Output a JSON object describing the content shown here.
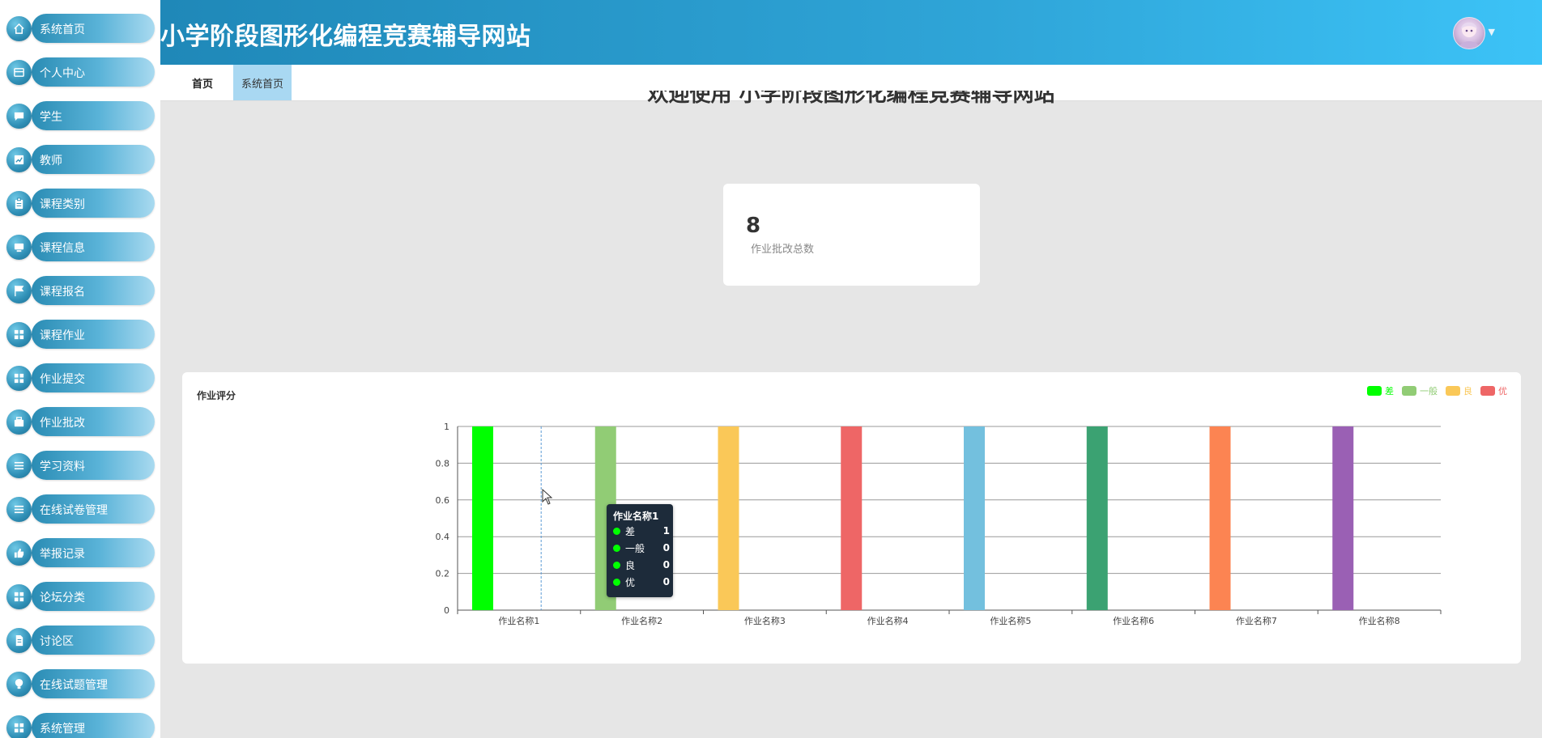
{
  "header": {
    "title": "小学阶段图形化编程竞赛辅导网站",
    "caret": "▼"
  },
  "tabs": [
    {
      "label": "首页"
    },
    {
      "label": "系统首页"
    }
  ],
  "sidebar": {
    "items": [
      {
        "label": "系统首页",
        "icon": "home-icon"
      },
      {
        "label": "个人中心",
        "icon": "id-card-icon"
      },
      {
        "label": "学生",
        "icon": "chat-icon"
      },
      {
        "label": "教师",
        "icon": "chart-icon"
      },
      {
        "label": "课程类别",
        "icon": "clipboard-icon"
      },
      {
        "label": "课程信息",
        "icon": "monitor-icon"
      },
      {
        "label": "课程报名",
        "icon": "flag-icon"
      },
      {
        "label": "课程作业",
        "icon": "grid-icon"
      },
      {
        "label": "作业提交",
        "icon": "grid-icon"
      },
      {
        "label": "作业批改",
        "icon": "briefcase-icon"
      },
      {
        "label": "学习资料",
        "icon": "list-icon"
      },
      {
        "label": "在线试卷管理",
        "icon": "list-icon"
      },
      {
        "label": "举报记录",
        "icon": "thumbs-up-icon"
      },
      {
        "label": "论坛分类",
        "icon": "grid-icon"
      },
      {
        "label": "讨论区",
        "icon": "document-icon"
      },
      {
        "label": "在线试题管理",
        "icon": "bulb-icon"
      },
      {
        "label": "系统管理",
        "icon": "grid-icon"
      }
    ]
  },
  "welcome": {
    "text": "欢迎使用 小学阶段图形化编程竞赛辅导网站"
  },
  "stat": {
    "value": "8",
    "label": "作业批改总数"
  },
  "chart_title": "作业评分",
  "chart_data": {
    "type": "bar",
    "title": "作业评分",
    "categories": [
      "作业名称1",
      "作业名称2",
      "作业名称3",
      "作业名称4",
      "作业名称5",
      "作业名称6",
      "作业名称7",
      "作业名称8"
    ],
    "bar_colors": [
      "#00ff00",
      "#91cc75",
      "#fac858",
      "#ee6666",
      "#73c0de",
      "#3ba272",
      "#fc8452",
      "#9a60b4"
    ],
    "series": [
      {
        "name": "差",
        "color": "#00ff00",
        "values": [
          1,
          0,
          0,
          0,
          0,
          0,
          0,
          0
        ]
      },
      {
        "name": "一般",
        "color": "#91cc75",
        "values": [
          0,
          1,
          0,
          0,
          0,
          0,
          0,
          0
        ]
      },
      {
        "name": "良",
        "color": "#fac858",
        "values": [
          0,
          0,
          1,
          0,
          0,
          0,
          0,
          0
        ]
      },
      {
        "name": "优",
        "color": "#ee6666",
        "values": [
          0,
          0,
          0,
          1,
          0,
          0,
          0,
          0
        ]
      }
    ],
    "extra_values": [
      0,
      0,
      0,
      0,
      1,
      1,
      1,
      1
    ],
    "y_ticks": [
      "0",
      "0.2",
      "0.4",
      "0.6",
      "0.8",
      "1"
    ],
    "ylim": [
      0,
      1
    ],
    "grid": true,
    "legend_position": "top-right"
  },
  "tooltip": {
    "title": "作业名称1",
    "rows": [
      {
        "name": "差",
        "value": "1"
      },
      {
        "name": "一般",
        "value": "0"
      },
      {
        "name": "良",
        "value": "0"
      },
      {
        "name": "优",
        "value": "0"
      }
    ],
    "dot_color": "#00ff00"
  }
}
